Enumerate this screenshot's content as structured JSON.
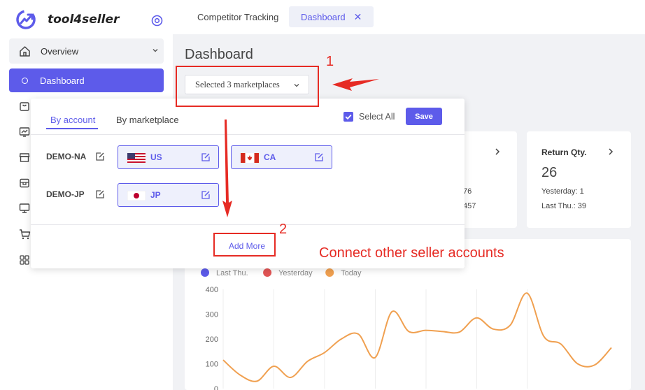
{
  "sidebar": {
    "brand": "tool4seller",
    "overview_label": "Overview",
    "dashboard_label": "Dashboard",
    "accent_color": "#5d5bea"
  },
  "topbar": {
    "tabs": [
      {
        "label": "Competitor Tracking"
      },
      {
        "label": "Dashboard"
      }
    ],
    "close_glyph": "✕"
  },
  "page": {
    "title": "Dashboard",
    "marketplace_select": "Selected 3 marketplaces"
  },
  "popup": {
    "tab_account": "By account",
    "tab_marketplace": "By marketplace",
    "select_all": "Select All",
    "save": "Save",
    "accounts": [
      {
        "name": "DEMO-NA",
        "marketplaces": [
          "US",
          "CA"
        ]
      },
      {
        "name": "DEMO-JP",
        "marketplaces": [
          "JP"
        ]
      }
    ],
    "add_more": "Add More"
  },
  "cards": {
    "partial_values": [
      "76",
      "457"
    ],
    "return": {
      "title": "Return Qty.",
      "value": "26",
      "yesterday": "Yesterday: 1",
      "last_thu": "Last Thu.: 39"
    }
  },
  "annotations": {
    "marker1": "1",
    "marker2": "2",
    "note": "Connect other seller accounts",
    "color": "#e62b24"
  },
  "chart_data": {
    "type": "line",
    "legend": [
      {
        "name": "Last Thu.",
        "color": "#5d5bea"
      },
      {
        "name": "Yesterday",
        "color": "#e25555"
      },
      {
        "name": "Today",
        "color": "#f0a050"
      }
    ],
    "yticks": [
      "400",
      "300",
      "200",
      "100",
      "0"
    ],
    "ylim": [
      0,
      400
    ],
    "series": [
      {
        "name": "Today",
        "color": "#f0a050",
        "x": [
          0,
          1,
          2,
          3,
          4,
          5,
          6,
          7,
          8,
          9,
          10,
          11,
          12,
          13,
          14,
          15,
          16,
          17,
          18,
          19,
          20,
          21,
          22,
          23
        ],
        "values": [
          115,
          55,
          30,
          90,
          45,
          110,
          145,
          200,
          220,
          125,
          310,
          230,
          235,
          230,
          228,
          285,
          240,
          255,
          385,
          210,
          180,
          100,
          95,
          165
        ]
      }
    ]
  }
}
